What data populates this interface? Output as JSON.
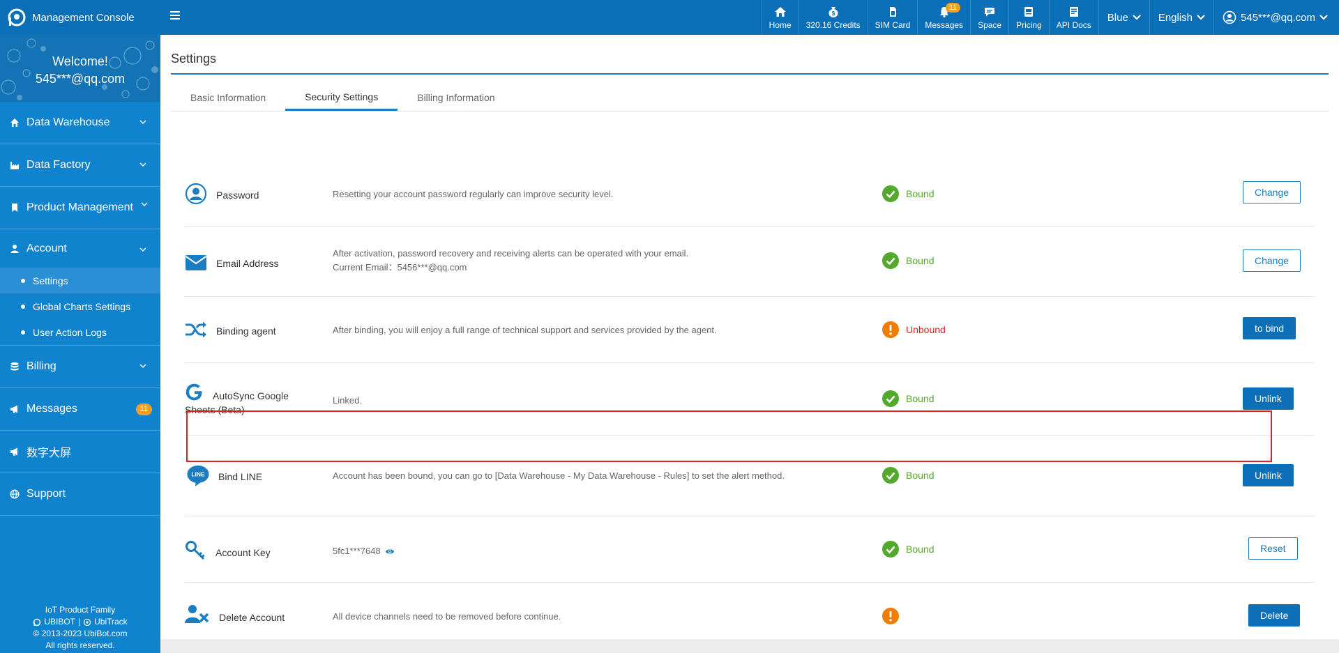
{
  "brand": {
    "title": "Management Console"
  },
  "topnav": {
    "items": [
      {
        "label": "Home",
        "icon": "home-icon"
      },
      {
        "label": "320.16 Credits",
        "icon": "credits-icon"
      },
      {
        "label": "SIM Card",
        "icon": "sim-card-icon"
      },
      {
        "label": "Messages",
        "icon": "bell-icon",
        "badge": "11"
      },
      {
        "label": "Space",
        "icon": "chat-icon"
      },
      {
        "label": "Pricing",
        "icon": "pricing-icon"
      },
      {
        "label": "API Docs",
        "icon": "api-docs-icon"
      }
    ],
    "theme": "Blue",
    "language": "English",
    "user": "545***@qq.com"
  },
  "sidebar": {
    "welcome": "Welcome!",
    "user_email": "545***@qq.com",
    "menu": [
      {
        "label": "Data Warehouse",
        "icon": "home-icon"
      },
      {
        "label": "Data Factory",
        "icon": "factory-icon"
      },
      {
        "label": "Product Management",
        "icon": "bookmark-icon"
      },
      {
        "label": "Account",
        "icon": "user-icon"
      },
      {
        "label": "Billing",
        "icon": "database-icon"
      },
      {
        "label": "Messages",
        "icon": "megaphone-icon",
        "badge": "11"
      },
      {
        "label": "数字大屏",
        "icon": "megaphone-icon"
      },
      {
        "label": "Support",
        "icon": "globe-icon"
      }
    ],
    "account_sub": [
      {
        "label": "Settings",
        "active": true
      },
      {
        "label": "Global Charts Settings",
        "active": false
      },
      {
        "label": "User Action Logs",
        "active": false
      }
    ],
    "footer": {
      "line1": "IoT Product Family",
      "brand_a": "UBIBOT",
      "separator": "|",
      "brand_b": "UbiTrack",
      "copyright": "© 2013-2023 UbiBot.com",
      "rights": "All rights reserved."
    }
  },
  "main": {
    "title": "Settings",
    "tabs": [
      {
        "label": "Basic Information",
        "active": false
      },
      {
        "label": "Security Settings",
        "active": true
      },
      {
        "label": "Billing Information",
        "active": false
      }
    ],
    "rows": [
      {
        "label": "Password",
        "desc": "Resetting your account password regularly can improve security level.",
        "status": "Bound",
        "state": "bound",
        "button": "Change"
      },
      {
        "label": "Email Address",
        "desc": "After activation, password recovery and receiving alerts can be operated with your email.",
        "desc2": "Current Email：5456***@qq.com",
        "status": "Bound",
        "state": "bound",
        "button": "Change"
      },
      {
        "label": "Binding agent",
        "desc": "After binding, you will enjoy a full range of technical support and services provided by the agent.",
        "status": "Unbound",
        "state": "unbound",
        "button": "to bind"
      },
      {
        "label": "AutoSync Google",
        "label2": "Sheets (Beta)",
        "desc": "Linked.",
        "status": "Bound",
        "state": "bound",
        "button": "Unlink"
      },
      {
        "label": "Bind LINE",
        "desc": "Account has been bound, you can go to [Data Warehouse - My Data Warehouse - Rules] to set the alert method.",
        "status": "Bound",
        "state": "bound",
        "button": "Unlink",
        "icon_text": "LINE"
      },
      {
        "label": "Account Key",
        "desc": "5fc1***7648",
        "status": "Bound",
        "state": "bound",
        "button": "Reset"
      },
      {
        "label": "Delete Account",
        "desc": "All device channels need to be removed before continue.",
        "status": "",
        "state": "warning",
        "button": "Delete"
      }
    ]
  },
  "colors": {
    "primary": "#0b6fb8",
    "sidebar": "#1083cf",
    "bound": "#52a92c",
    "unbound": "#e02020",
    "warning": "#f07d00",
    "badge": "#f0a020"
  }
}
